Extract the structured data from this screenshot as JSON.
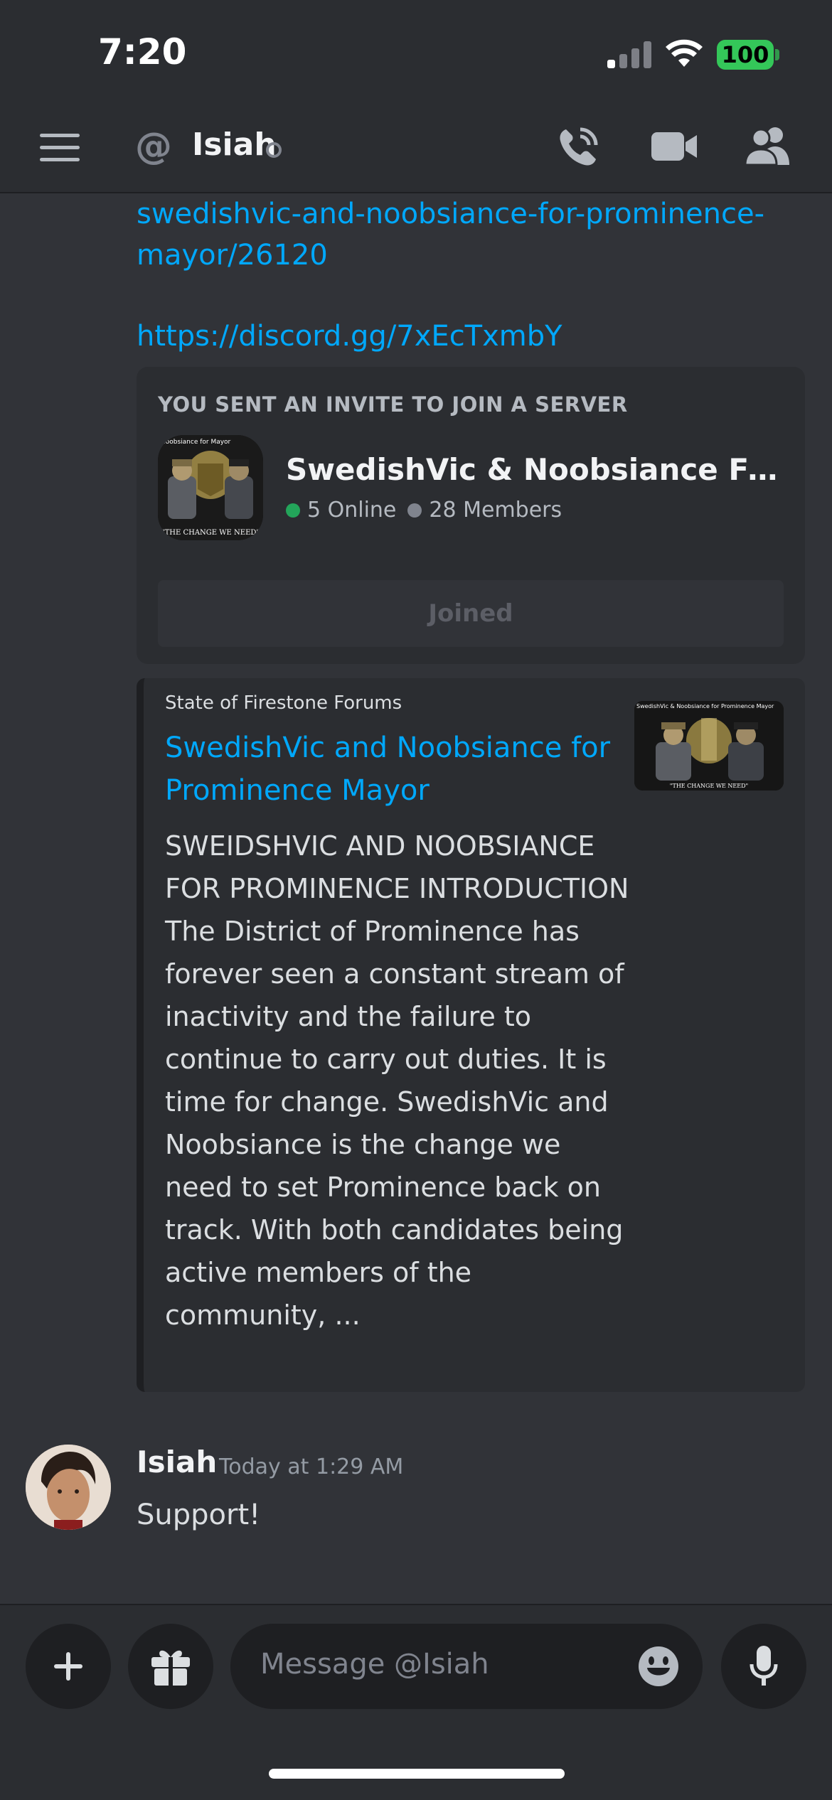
{
  "status_bar": {
    "time": "7:20",
    "battery": "100"
  },
  "header": {
    "dm_name": "Isiah"
  },
  "messages": {
    "link_part": "swedishvic-and-noobsiance-for-prominence-mayor/26120",
    "invite_link": "https://discord.gg/7xEcTxmbY",
    "invite": {
      "heading": "YOU SENT AN INVITE TO JOIN A SERVER",
      "server_name": "SwedishVic & Noobsiance For Prominence Mayor",
      "online": "5 Online",
      "members": "28 Members",
      "button_label": "Joined",
      "icon_text": "\"THE CHANGE WE NEED\"",
      "icon_top_text": "Noobsiance for Mayor"
    },
    "embed": {
      "provider": "State of Firestone Forums",
      "title": "SwedishVic and Noobsiance for Prominence Mayor",
      "description": "SWEIDSHVIC AND NOOBSIANCE FOR PROMINENCE INTRODUCTION  The District of Prominence has forever seen a constant stream of inactivity and the failure to continue to carry out duties. It is time for change. SwedishVic and Noobsiance is the change we need to set Prominence back on track. With both candidates being active members of the community, ...",
      "thumb_top_text": "SwedishVic & Noobsiance for Prominence Mayor",
      "thumb_caption": "\"THE CHANGE WE NEED\""
    },
    "last_message": {
      "author": "Isiah",
      "timestamp": "Today at 1:29 AM",
      "text": "Support!"
    }
  },
  "composer": {
    "placeholder": "Message @Isiah"
  },
  "colors": {
    "background": "#313338",
    "link": "#00a8fc",
    "online": "#23a55a",
    "offline": "#80848e"
  }
}
